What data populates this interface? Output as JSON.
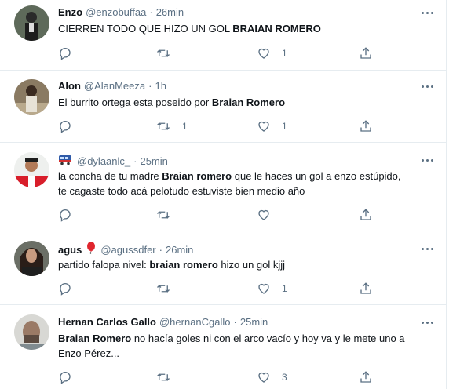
{
  "colors": {
    "text": "#0f1419",
    "secondary": "#5b7083",
    "divider": "#e6ecf0",
    "icon": "#5b7083"
  },
  "tweets": [
    {
      "name": "Enzo",
      "handle": "@enzobuffaa",
      "time": "26min",
      "badge": "",
      "text_parts": [
        "CIERREN TODO QUE HIZO UN GOL ",
        "BRAIAN ROMERO",
        ""
      ],
      "text_line2": "",
      "replies": "",
      "retweets": "",
      "likes": "1"
    },
    {
      "name": "Alon",
      "handle": "@AlanMeeza",
      "time": "1h",
      "badge": "",
      "text_parts": [
        "El burrito ortega esta poseido por ",
        "Braian Romero",
        ""
      ],
      "text_line2": "",
      "replies": "",
      "retweets": "1",
      "likes": "1"
    },
    {
      "name": "",
      "handle": "@dylaanlc_",
      "time": "25min",
      "badge": "train-emoji",
      "text_parts": [
        "la concha de tu madre ",
        "Braian romero",
        " que le haces un gol a enzo estúpido,"
      ],
      "text_line2": "te cagaste todo acá pelotudo estuviste bien medio año",
      "replies": "",
      "retweets": "",
      "likes": ""
    },
    {
      "name": "agus",
      "handle": "@agussdfer",
      "time": "26min",
      "badge": "balloon-emoji",
      "text_parts": [
        "partido falopa nivel: ",
        "braian romero",
        " hizo un gol kjjj"
      ],
      "text_line2": "",
      "replies": "",
      "retweets": "",
      "likes": "1"
    },
    {
      "name": "Hernan Carlos Gallo",
      "handle": "@hernanCgallo",
      "time": "25min",
      "badge": "",
      "text_parts": [
        "",
        "Braian Romero",
        " no hacía goles ni con el arco vacío y hoy va y le mete uno a"
      ],
      "text_line2": "Enzo Pérez...",
      "replies": "",
      "retweets": "",
      "likes": "3"
    }
  ]
}
